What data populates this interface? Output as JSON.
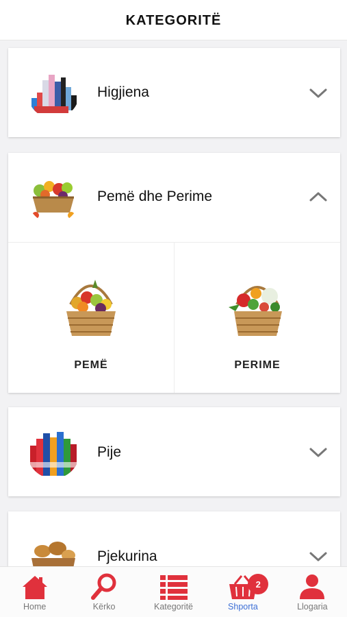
{
  "header": {
    "title": "KATEGORITË"
  },
  "categories": [
    {
      "label": "Higjiena",
      "expanded": false
    },
    {
      "label": "Pemë dhe Perime",
      "expanded": true,
      "subcategories": [
        {
          "label": "PEMË"
        },
        {
          "label": "PERIME"
        }
      ]
    },
    {
      "label": "Pije",
      "expanded": false
    },
    {
      "label": "Pjekurina",
      "expanded": false
    }
  ],
  "tabbar": {
    "tabs": [
      {
        "label": "Home",
        "icon": "home-icon"
      },
      {
        "label": "Kërko",
        "icon": "search-icon"
      },
      {
        "label": "Kategoritë",
        "icon": "list-icon"
      },
      {
        "label": "Shporta",
        "icon": "basket-icon",
        "active": true,
        "badge": "2"
      },
      {
        "label": "Llogaria",
        "icon": "user-icon"
      }
    ]
  },
  "colors": {
    "accent": "#e0313c",
    "active_tab": "#3d6fd6"
  }
}
